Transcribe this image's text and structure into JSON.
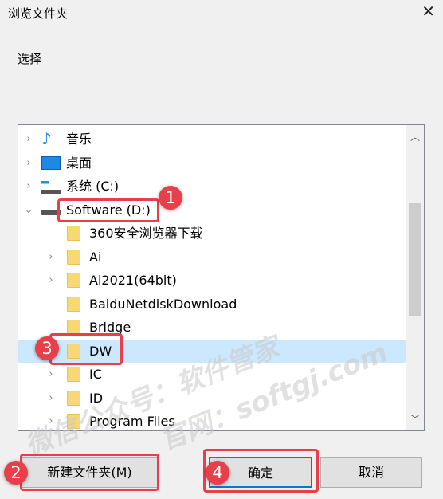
{
  "window": {
    "title": "浏览文件夹",
    "close": "✕"
  },
  "prompt": "选择",
  "tree": {
    "items": [
      {
        "label": "音乐",
        "icon": "music-icon",
        "level": 1,
        "expander": "collapsed"
      },
      {
        "label": "桌面",
        "icon": "desktop-icon",
        "level": 1,
        "expander": "collapsed"
      },
      {
        "label": "系统 (C:)",
        "icon": "system-drive-icon",
        "level": 1,
        "expander": "collapsed"
      },
      {
        "label": "Software (D:)",
        "icon": "drive-icon",
        "level": 1,
        "expander": "expanded"
      },
      {
        "label": "360安全浏览器下载",
        "icon": "folder-icon",
        "level": 2,
        "expander": "none"
      },
      {
        "label": "Ai",
        "icon": "folder-icon",
        "level": 2,
        "expander": "collapsed"
      },
      {
        "label": "Ai2021(64bit)",
        "icon": "folder-icon",
        "level": 2,
        "expander": "collapsed"
      },
      {
        "label": "BaiduNetdiskDownload",
        "icon": "folder-icon",
        "level": 2,
        "expander": "none"
      },
      {
        "label": "Bridge",
        "icon": "folder-icon",
        "level": 2,
        "expander": "none"
      },
      {
        "label": "DW",
        "icon": "folder-icon",
        "level": 2,
        "expander": "none",
        "selected": true
      },
      {
        "label": "IC",
        "icon": "folder-icon",
        "level": 2,
        "expander": "collapsed"
      },
      {
        "label": "ID",
        "icon": "folder-icon",
        "level": 2,
        "expander": "collapsed"
      },
      {
        "label": "Program Files",
        "icon": "folder-icon",
        "level": 2,
        "expander": "collapsed"
      }
    ]
  },
  "buttons": {
    "new_folder": "新建文件夹(M)",
    "ok": "确定",
    "cancel": "取消"
  },
  "annotations": [
    "1",
    "2",
    "3",
    "4"
  ],
  "watermark": [
    "微信公众号：软件管家",
    "官网：softgj.com"
  ],
  "colors": {
    "annotation": "#e8404a",
    "selection": "#cce8ff",
    "default_button_border": "#0078d7"
  }
}
